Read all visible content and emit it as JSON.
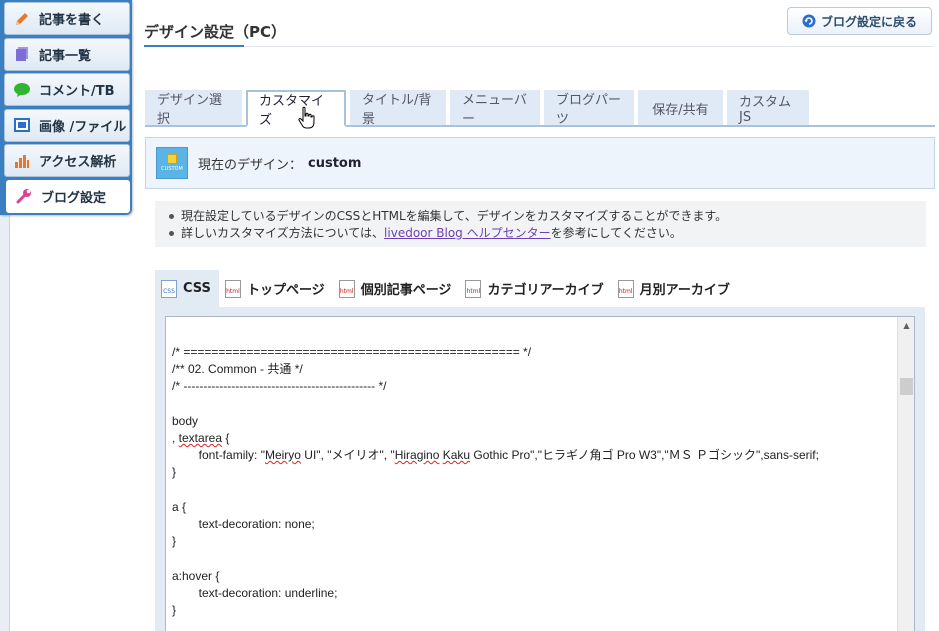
{
  "sidebar": {
    "items": [
      {
        "label": "記事を書く",
        "icon": "pencil-icon",
        "color": "#e8782a"
      },
      {
        "label": "記事一覧",
        "icon": "document-list-icon",
        "color": "#7d6dd6"
      },
      {
        "label": "コメント/TB",
        "icon": "speech-bubble-icon",
        "color": "#2fb52f"
      },
      {
        "label": "画像 /ファイル",
        "icon": "image-icon",
        "color": "#2a6fc9"
      },
      {
        "label": "アクセス解析",
        "icon": "bar-chart-icon",
        "color": "#e8782a"
      },
      {
        "label": "ブログ設定",
        "icon": "wrench-icon",
        "color": "#e0409a",
        "active": true
      }
    ]
  },
  "header": {
    "title": "デザイン設定（PC）",
    "back_button": "ブログ設定に戻る"
  },
  "tabs": [
    {
      "label": "デザイン選択"
    },
    {
      "label": "カスタマイズ",
      "active": true
    },
    {
      "label": "タイトル/背景"
    },
    {
      "label": "メニューバー"
    },
    {
      "label": "ブログパーツ"
    },
    {
      "label": "保存/共有"
    },
    {
      "label": "カスタムJS"
    }
  ],
  "current_design": {
    "label": "現在のデザイン：",
    "value": "custom",
    "thumb_label": "CUSTOM"
  },
  "notes": {
    "line1": "現在設定しているデザインのCSSとHTMLを編集して、デザインをカスタマイズすることができます。",
    "line2_prefix": "詳しいカスタマイズ方法については、",
    "line2_link": "livedoor Blog ヘルプセンター",
    "line2_suffix": "を参考にしてください。"
  },
  "file_tabs": [
    {
      "label": "CSS",
      "icon_text": "CSS",
      "active": true
    },
    {
      "label": "トップページ",
      "icon_text": "html"
    },
    {
      "label": "個別記事ページ",
      "icon_text": "html"
    },
    {
      "label": "カテゴリアーカイブ",
      "icon_text": "html"
    },
    {
      "label": "月別アーカイブ",
      "icon_text": "html"
    }
  ],
  "code": {
    "l1": "/* ================================================ */",
    "l2": "/** 02. Common - 共通 */",
    "l3": "/* ------------------------------------------------ */",
    "l4": "",
    "l5": "body",
    "l6_a": ", ",
    "l6_b": "textarea",
    "l6_c": " {",
    "l7_a": "        font-family: \"",
    "l7_b": "Meiryo",
    "l7_c": " UI\", \"メイリオ\", \"",
    "l7_d": "Hiragino",
    "l7_e": " ",
    "l7_f": "Kaku",
    "l7_g": " Gothic Pro\",\"ヒラギノ角ゴ Pro W3\",\"ＭＳ Ｐゴシック\",sans-serif;",
    "l8": "}",
    "l9": "",
    "l10": "a {",
    "l11": "        text-decoration: none;",
    "l12": "}",
    "l13": "",
    "l14": "a:hover {",
    "l15": "        text-decoration: underline;",
    "l16": "}"
  }
}
